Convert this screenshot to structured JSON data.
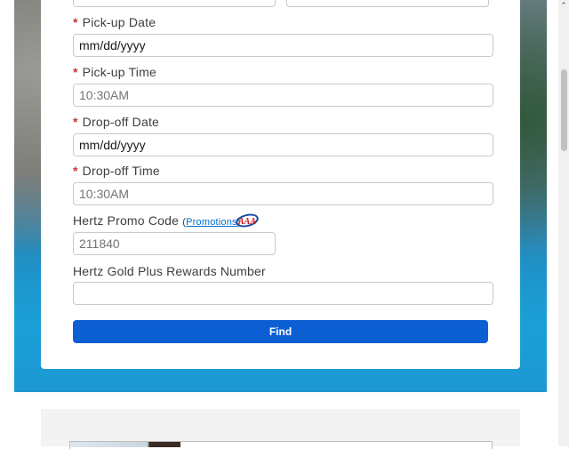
{
  "form": {
    "pickup_date": {
      "label": "Pick-up Date",
      "value": "mm/dd/yyyy"
    },
    "pickup_time": {
      "label": "Pick-up Time",
      "value": "10:30AM"
    },
    "dropoff_date": {
      "label": "Drop-off Date",
      "value": "mm/dd/yyyy"
    },
    "dropoff_time": {
      "label": "Drop-off Time",
      "value": "10:30AM"
    },
    "promo_code": {
      "label": "Hertz Promo Code",
      "link_label": "Promotions",
      "paren_open": "(",
      "paren_close": ")",
      "value": "211840",
      "badge_icon": "aaa-logo-icon"
    },
    "gold_plus": {
      "label": "Hertz Gold Plus Rewards Number",
      "value": ""
    },
    "required_marker": "*",
    "find_label": "Find"
  },
  "scrollbar": {
    "up_glyph": "⌃"
  },
  "colors": {
    "required": "#c23934",
    "button": "#0b5fd3",
    "link": "#0070d2"
  }
}
